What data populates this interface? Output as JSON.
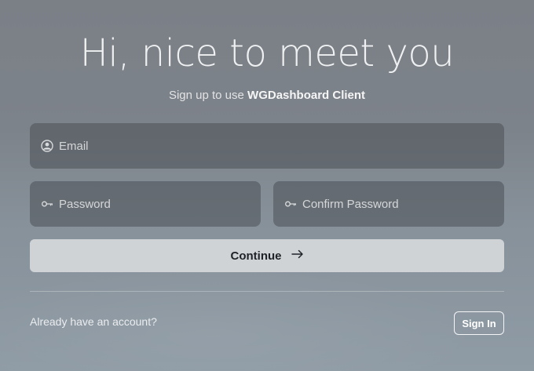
{
  "heading": "Hi, nice to meet you",
  "subtitle": {
    "prefix": "Sign up to use",
    "app_name": "WGDashboard Client"
  },
  "form": {
    "email": {
      "placeholder": "Email",
      "icon": "person-circle-icon"
    },
    "password": {
      "placeholder": "Password",
      "icon": "key-icon"
    },
    "confirm_password": {
      "placeholder": "Confirm Password",
      "icon": "key-icon"
    },
    "continue_label": "Continue",
    "continue_icon": "arrow-right-icon"
  },
  "footer": {
    "already_text": "Already have an account?",
    "signin_label": "Sign In"
  },
  "colors": {
    "button_bg": "#d0d3d6",
    "field_bg": "#4b5056"
  }
}
